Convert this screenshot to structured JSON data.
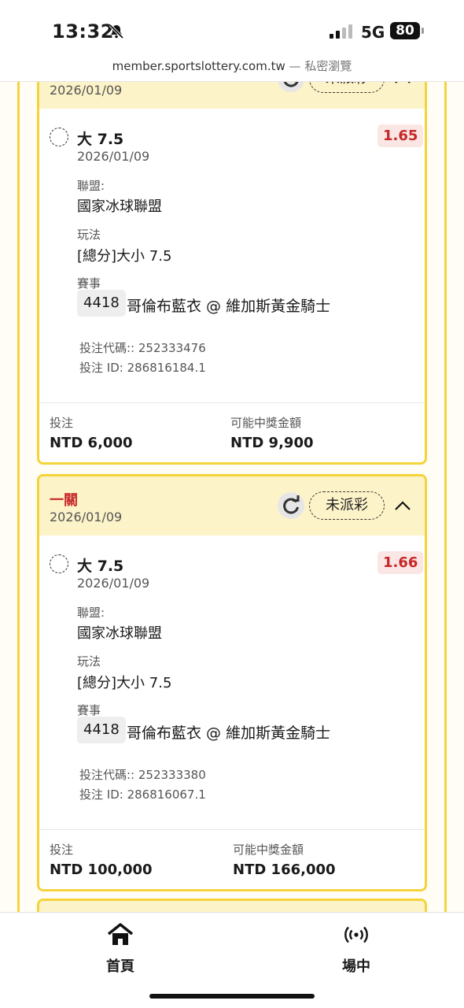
{
  "status_bar": {
    "time": "13:32",
    "network": "5G",
    "battery": "80"
  },
  "browser": {
    "url": "member.sportslottery.com.tw",
    "separator": " — ",
    "mode": "私密瀏覽"
  },
  "cards": [
    {
      "title": "",
      "date": "2026/01/09",
      "status": "未派彩",
      "selection": {
        "name": "大 7.5",
        "date": "2026/01/09",
        "odds": "1.65",
        "league_label": "聯盟:",
        "league": "國家冰球聯盟",
        "market_label": "玩法",
        "market": "[總分]大小 7.5",
        "event_label": "賽事",
        "game_code": "4418",
        "game_name": "哥倫布藍衣 @ 維加斯黃金騎士",
        "bet_code": "投注代碼:: 252333476",
        "bet_id": "投注 ID: 286816184.1"
      },
      "footer": {
        "stake_label": "投注",
        "stake": "NTD 6,000",
        "payout_label": "可能中獎金額",
        "payout": "NTD 9,900"
      }
    },
    {
      "title": "一關",
      "date": "2026/01/09",
      "status": "未派彩",
      "selection": {
        "name": "大 7.5",
        "date": "2026/01/09",
        "odds": "1.66",
        "league_label": "聯盟:",
        "league": "國家冰球聯盟",
        "market_label": "玩法",
        "market": "[總分]大小 7.5",
        "event_label": "賽事",
        "game_code": "4418",
        "game_name": "哥倫布藍衣 @ 維加斯黃金騎士",
        "bet_code": "投注代碼:: 252333380",
        "bet_id": "投注 ID: 286816067.1"
      },
      "footer": {
        "stake_label": "投注",
        "stake": "NTD 100,000",
        "payout_label": "可能中獎金額",
        "payout": "NTD 166,000"
      }
    }
  ],
  "tab_bar": {
    "home_label": "首頁",
    "home_icon": "home-icon",
    "live_label": "場中",
    "live_icon": "broadcast-icon"
  },
  "colors": {
    "accent_yellow": "#f5d33a",
    "header_bg": "#fdf3c8",
    "odds_red": "#c62828"
  }
}
